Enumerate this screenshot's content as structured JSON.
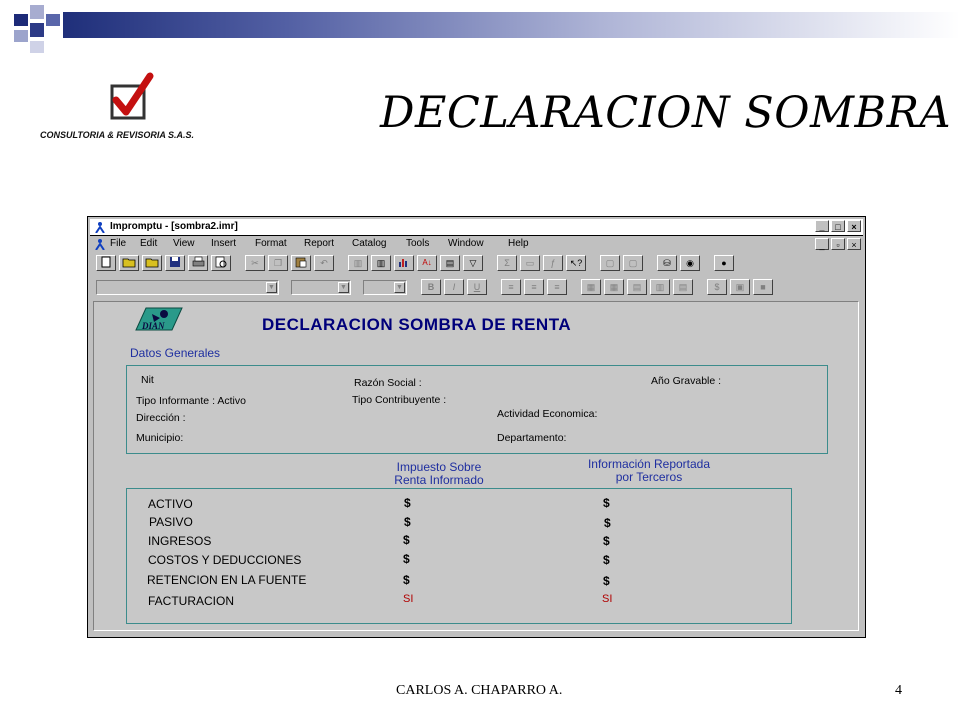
{
  "slide": {
    "title": "DECLARACION SOMBRA",
    "logo_text": "CONSULTORIA & REVISORIA S.A.S.",
    "footer_author": "CARLOS A. CHAPARRO A.",
    "page_number": "4"
  },
  "window": {
    "title": "Impromptu - [sombra2.imr]",
    "buttons": [
      "_",
      "□",
      "×"
    ],
    "doc_buttons": [
      "_",
      "▫",
      "×"
    ]
  },
  "menu": [
    "File",
    "Edit",
    "View",
    "Insert",
    "Format",
    "Report",
    "Catalog",
    "Tools",
    "Window",
    "Help"
  ],
  "toolbar": {
    "icons": [
      "new-icon",
      "open-icon",
      "open-report-icon",
      "save-icon",
      "print-icon",
      "preview-icon",
      "cut-icon",
      "copy-icon",
      "paste-icon",
      "undo-icon",
      "list-icon",
      "columns-icon",
      "chart-icon",
      "sort-icon",
      "group-icon",
      "filter-icon",
      "sum-icon",
      "calculate-icon",
      "function-icon",
      "help-pointer-icon",
      "frame-icon",
      "frame2-icon",
      "database-icon",
      "camera-icon",
      "tools-icon"
    ]
  },
  "format_bar": {
    "bold": "B",
    "italic": "I",
    "underline": "U"
  },
  "report": {
    "logo_text": "DIAN",
    "title": "DECLARACION SOMBRA DE RENTA",
    "section": "Datos Generales",
    "fields": {
      "nit": "Nit",
      "razon_social": "Razón Social :",
      "ano_gravable": "Año Gravable :",
      "tipo_informante": "Tipo Informante : Activo",
      "tipo_contribuyente": "Tipo Contribuyente :",
      "direccion": "Dirección :",
      "actividad": "Actividad Economica:",
      "municipio": "Municipio:",
      "departamento": "Departamento:"
    },
    "col1_header_l1": "Impuesto Sobre",
    "col1_header_l2": "Renta Informado",
    "col2_header_l1": "Información Reportada",
    "col2_header_l2": "por Terceros",
    "rows": [
      {
        "label": "ACTIVO",
        "col1": "$",
        "col2": "$"
      },
      {
        "label": "PASIVO",
        "col1": "$",
        "col2": "$"
      },
      {
        "label": "INGRESOS",
        "col1": "$",
        "col2": "$"
      },
      {
        "label": "COSTOS Y DEDUCCIONES",
        "col1": "$",
        "col2": "$"
      },
      {
        "label": "RETENCION EN LA FUENTE",
        "col1": "$",
        "col2": "$"
      },
      {
        "label": "FACTURACION",
        "col1": "SI",
        "col2": "SI"
      }
    ]
  },
  "colors": {
    "report_title": "#00007a",
    "label_blue": "#1f2fa0",
    "si_red": "#b00000",
    "box_border": "#3c8c8c"
  }
}
